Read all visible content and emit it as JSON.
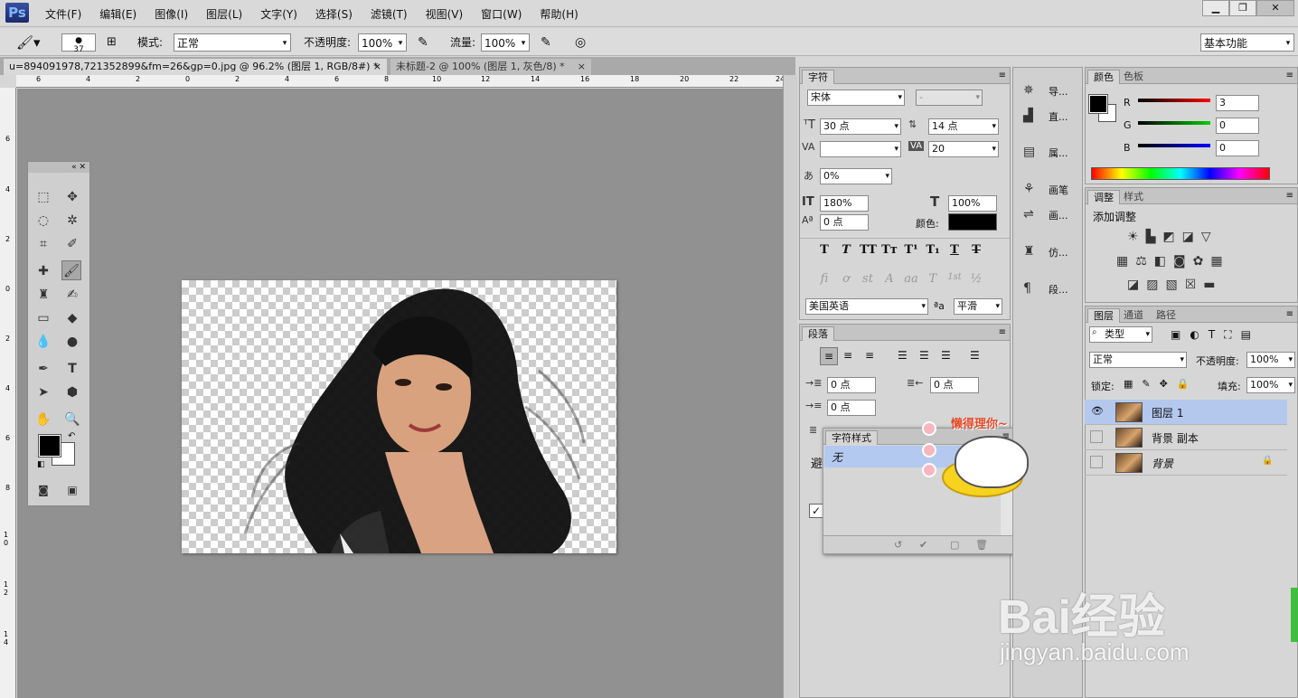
{
  "menubar": {
    "logo": "Ps",
    "items": [
      "文件(F)",
      "编辑(E)",
      "图像(I)",
      "图层(L)",
      "文字(Y)",
      "选择(S)",
      "滤镜(T)",
      "视图(V)",
      "窗口(W)",
      "帮助(H)"
    ],
    "window_buttons": [
      "▁",
      "❐",
      "✕"
    ]
  },
  "options": {
    "brush_size": "37",
    "mode_label": "模式:",
    "mode_value": "正常",
    "opacity_label": "不透明度:",
    "opacity_value": "100%",
    "flow_label": "流量:",
    "flow_value": "100%",
    "workspace": "基本功能"
  },
  "documents": [
    {
      "title": "u=894091978,721352899&fm=26&gp=0.jpg @ 96.2% (图层 1, RGB/8#) *",
      "close": "×"
    },
    {
      "title": "未标题-2 @ 100% (图层 1, 灰色/8) *",
      "close": "×"
    }
  ],
  "ruler": {
    "h": [
      "6",
      "4",
      "2",
      "0",
      "2",
      "4",
      "6",
      "8",
      "10",
      "12",
      "14",
      "16",
      "18",
      "20",
      "22",
      "24"
    ],
    "v": [
      "6",
      "4",
      "2",
      "0",
      "2",
      "4",
      "6",
      "8",
      "1 0",
      "1 2",
      "1 4"
    ]
  },
  "character_panel": {
    "tab": "字符",
    "font_family": "宋体",
    "font_style": "-",
    "size": "30 点",
    "leading": "14 点",
    "kerning": "",
    "tracking": "20",
    "scale_pct": "0%",
    "vertical_scale": "180%",
    "horizontal_scale": "100%",
    "baseline": "0 点",
    "color_label": "颜色:",
    "style_buttons": [
      "T",
      "T",
      "TT",
      "Tт",
      "T¹",
      "T₁",
      "T",
      "T"
    ],
    "ot_buttons": [
      "fi",
      "ơ",
      "st",
      "A",
      "aa",
      "T",
      "1st",
      "½"
    ],
    "language": "美国英语",
    "aa_label": "ªa",
    "antialias": "平滑"
  },
  "paragraph_panel": {
    "tab": "段落",
    "indent_left": "0 点",
    "indent_right": "0 点",
    "indent_first": "0 点",
    "hyphen_label": "避"
  },
  "char_style_panel": {
    "tab": "字符样式",
    "item": "无"
  },
  "mini_panels": [
    "导...",
    "直...",
    "属...",
    "画笔",
    "画...",
    "仿...",
    "段..."
  ],
  "color_panel": {
    "tabs": [
      "颜色",
      "色板"
    ],
    "r_label": "R",
    "g_label": "G",
    "b_label": "B",
    "r": "3",
    "g": "0",
    "b": "0"
  },
  "adjustments_panel": {
    "tabs": [
      "调整",
      "样式"
    ],
    "title": "添加调整"
  },
  "layers_panel": {
    "tabs": [
      "图层",
      "通道",
      "路径"
    ],
    "filter_type": "类型",
    "blend_mode": "正常",
    "opacity_label": "不透明度:",
    "opacity": "100%",
    "lock_label": "锁定:",
    "fill_label": "填充:",
    "fill": "100%",
    "layers": [
      {
        "name": "图层 1",
        "visible": "👁",
        "selected": true
      },
      {
        "name": "背景 副本",
        "visible": "",
        "selected": false
      },
      {
        "name": "背景",
        "visible": "",
        "selected": false,
        "lock": "🔒"
      }
    ]
  },
  "overlay": {
    "sticker_text": "懒得理你~",
    "watermark_brand": "Bai经验",
    "watermark_url": "jingyan.baidu.com"
  }
}
